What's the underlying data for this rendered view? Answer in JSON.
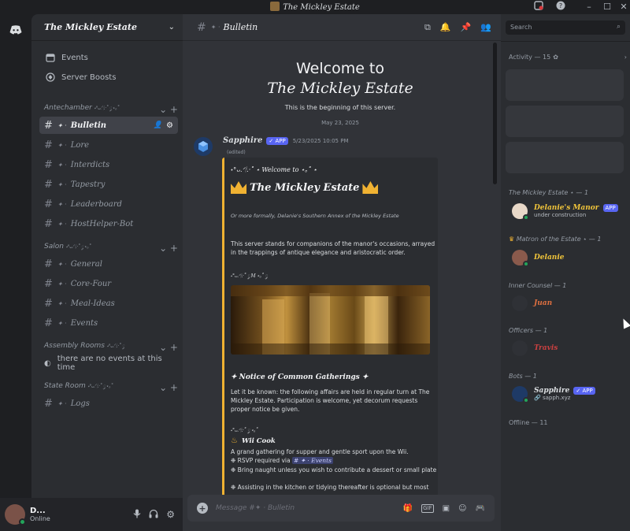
{
  "window": {
    "title": "The Mickley Estate"
  },
  "server": {
    "name": "The Mickley Estate"
  },
  "sidebar": {
    "links": [
      {
        "label": "Events"
      },
      {
        "label": "Server Boosts"
      }
    ],
    "categories": [
      {
        "name": "Antechamber",
        "deco": "˖°ᴗ.ᐟ🕯.·˚ ༘ ⋆｡˚",
        "channels": [
          "Bulletin",
          "Lore",
          "Interdicts",
          "Tapestry",
          "Leaderboard",
          "HostHelper-Bot"
        ]
      },
      {
        "name": "Salon",
        "deco": "˖°ᴗ.ᐟ🕯.·˚ ༘ ⋆｡˚",
        "channels": [
          "General",
          "Core-Four",
          "Meal-Ideas",
          "Events"
        ]
      },
      {
        "name": "Assembly Rooms",
        "deco": "˖°ᴗ.ᐟ🕯.·˚ ༘",
        "channels": []
      },
      {
        "name": "State Room",
        "deco": "˖°ᴗ.ᐟ🕯.·˚ ༘ ⋆｡˚",
        "channels": [
          "Logs"
        ]
      }
    ],
    "no_events": "there are no events at this time"
  },
  "user": {
    "name": "D...",
    "status": "Online"
  },
  "chat": {
    "channel_name": "Bulletin",
    "welcome_line1": "Welcome to",
    "welcome_line2": "The Mickley Estate",
    "welcome_sub": "This is the beginning of this server.",
    "date_divider": "May 23, 2025",
    "message": {
      "author": "Sapphire",
      "badge": "✓ APP",
      "timestamp": "5/23/2025 10:05 PM",
      "edited": "(edited)",
      "embed1": {
        "kicker": "˖°ᴗ.ᐟ🕯.·˚ ⋆ Welcome to ⋆｡˚ ⋆",
        "title": "The Mickley Estate",
        "subtitle": "Or more formally, Delanie's Southern Annex of the Mickley Estate",
        "body": "This server stands for companions of the manor's occasions, arrayed in the trappings of antique elegance and aristocratic order.",
        "divider": "˖°ᴗ.ᐟ🕯.·˚ ༘ M ⋆｡˚ ༘"
      },
      "embed2": {
        "heading": "✦ Notice of Common Gatherings ✦",
        "body": "Let it be known: the following affairs are held in regular turn at The Mickley Estate. Participation is welcome, yet decorum requests proper notice be given.",
        "divider": "˖°ᴗ.ᐟ🕯.·˚ ༘ ⋆｡˚",
        "event_title": "Wii Cook",
        "event_desc": "A grand gathering for supper and gentle sport upon the Wii.",
        "rsvp_prefix": "❉ RSVP required via",
        "rsvp_channel": "# ✦ · Events",
        "bullet2": "❉ Bring naught unless you wish to contribute a dessert or small plate",
        "bullet3": "❉ Assisting in the kitchen or tidying thereafter is optional but most"
      }
    },
    "composer_placeholder": "Message #✦ · Bulletin"
  },
  "members": {
    "search_placeholder": "Search",
    "activity_label": "Activity — 15",
    "groups": [
      {
        "role": "The Mickley Estate ⋆ — 1",
        "members": [
          {
            "name": "Delanie's Manor",
            "badge": "APP",
            "sub": "under construction",
            "color": "#f0c43a"
          }
        ]
      },
      {
        "role": "Matron of the Estate ⋆ — 1",
        "members": [
          {
            "name": "Delanie",
            "color": "#f0c43a"
          }
        ]
      },
      {
        "role": "Inner Counsel — 1",
        "members": [
          {
            "name": "Juan",
            "color": "#e07040"
          }
        ]
      },
      {
        "role": "Officers — 1",
        "members": [
          {
            "name": "Travis",
            "color": "#c94040"
          }
        ]
      },
      {
        "role": "Bots — 1",
        "members": [
          {
            "name": "Sapphire",
            "badge": "✓ APP",
            "sub": "sapph.xyz",
            "color": "#dbdee1"
          }
        ]
      }
    ],
    "offline_label": "Offline — 11"
  }
}
